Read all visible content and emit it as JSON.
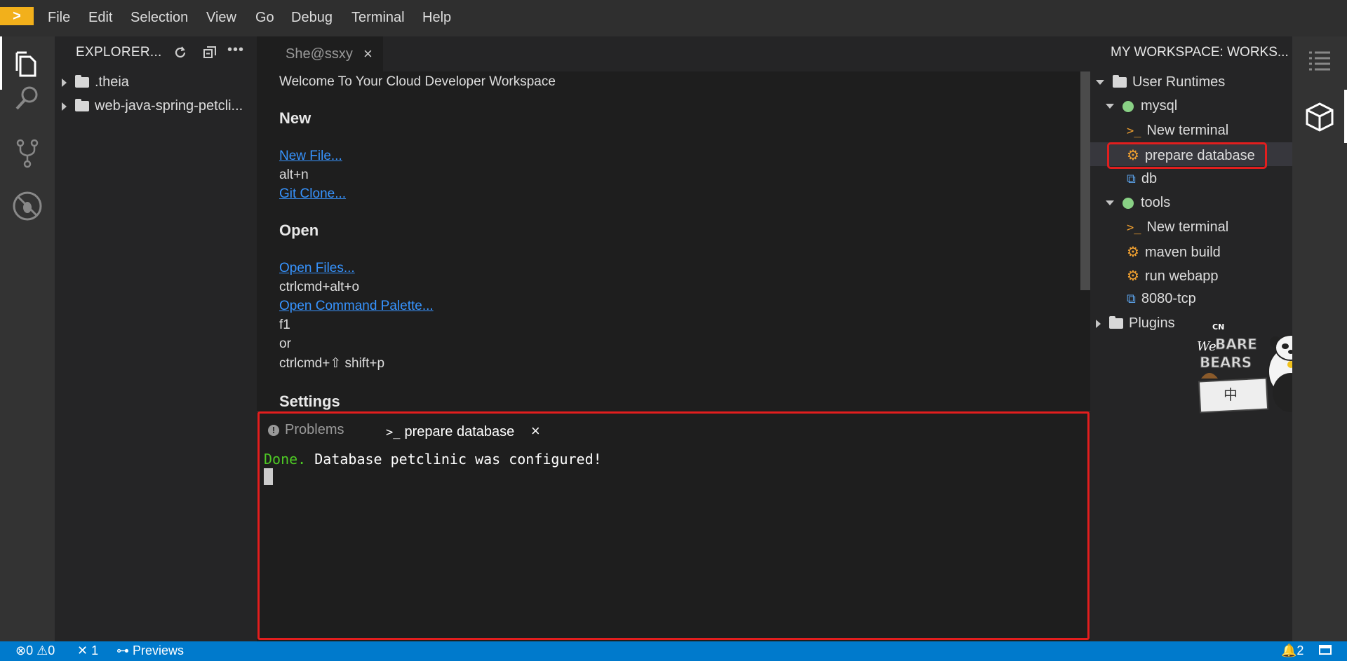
{
  "menubar": {
    "logo_glyph": ">",
    "items": [
      "File",
      "Edit",
      "Selection",
      "View",
      "Go",
      "Debug",
      "Terminal",
      "Help"
    ]
  },
  "activity_bar": {
    "icons": [
      "files-icon",
      "search-icon",
      "source-control-icon",
      "debug-icon"
    ]
  },
  "explorer": {
    "title": "EXPLORER...",
    "items": [
      ".theia",
      "web-java-spring-petcli..."
    ]
  },
  "editor": {
    "tab_label": "She@ssxy",
    "welcome": "Welcome To Your Cloud Developer Workspace",
    "new_heading": "New",
    "new_file": "New File...",
    "new_file_key": "alt+n",
    "git_clone": "Git Clone...",
    "open_heading": "Open",
    "open_files": "Open Files...",
    "open_files_key": "ctrlcmd+alt+o",
    "open_command_palette": "Open Command Palette...",
    "palette_key_1": "f1",
    "palette_or": "or",
    "palette_key_2": "ctrlcmd+⇧ shift+p",
    "settings_heading": "Settings"
  },
  "panel": {
    "tabs": [
      "Problems",
      "prepare database"
    ],
    "terminal_done": "Done.",
    "terminal_message": "Database petclinic was configured!"
  },
  "workspace": {
    "title": "MY WORKSPACE: WORKS...",
    "user_runtimes": "User Runtimes",
    "machines": [
      {
        "name": "mysql",
        "commands": [
          {
            "type": "terminal",
            "label": "New terminal"
          },
          {
            "type": "command",
            "label": "prepare database"
          },
          {
            "type": "endpoint",
            "label": "db"
          }
        ]
      },
      {
        "name": "tools",
        "commands": [
          {
            "type": "terminal",
            "label": "New terminal"
          },
          {
            "type": "command",
            "label": "maven build"
          },
          {
            "type": "command",
            "label": "run webapp"
          },
          {
            "type": "endpoint",
            "label": "8080-tcp"
          }
        ]
      }
    ],
    "plugins": "Plugins"
  },
  "sticker": {
    "brand_top": "CN",
    "brand_we": "We",
    "brand_bare": "BARE",
    "brand_bears": "BEARS",
    "chinese": "中"
  },
  "statusbar": {
    "errors": "0",
    "warnings": "0",
    "tools_count": "1",
    "previews": "Previews",
    "notifications": "2"
  },
  "colors": {
    "accent": "#007acc",
    "highlight_border": "#e21e1e",
    "terminal_green": "#4ec924",
    "link": "#3794ff",
    "runtime_dot": "#89d185"
  }
}
